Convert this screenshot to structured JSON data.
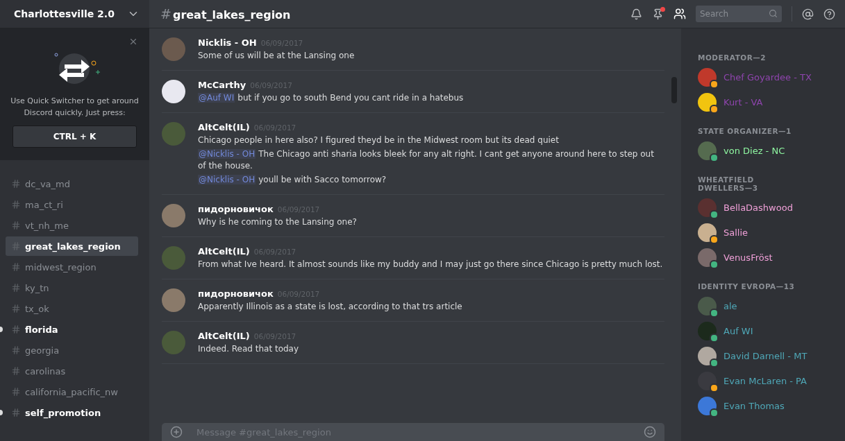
{
  "server": {
    "name": "Charlottesville 2.0"
  },
  "popup": {
    "text": "Use Quick Switcher to get around Discord quickly. Just press:",
    "shortcut": "CTRL + K"
  },
  "channels": [
    {
      "name": "dc_va_md",
      "selected": false,
      "unread": false
    },
    {
      "name": "ma_ct_ri",
      "selected": false,
      "unread": false
    },
    {
      "name": "vt_nh_me",
      "selected": false,
      "unread": false
    },
    {
      "name": "great_lakes_region",
      "selected": true,
      "unread": false
    },
    {
      "name": "midwest_region",
      "selected": false,
      "unread": false
    },
    {
      "name": "ky_tn",
      "selected": false,
      "unread": false
    },
    {
      "name": "tx_ok",
      "selected": false,
      "unread": false
    },
    {
      "name": "florida",
      "selected": false,
      "unread": true
    },
    {
      "name": "georgia",
      "selected": false,
      "unread": false
    },
    {
      "name": "carolinas",
      "selected": false,
      "unread": false
    },
    {
      "name": "california_pacific_nw",
      "selected": false,
      "unread": false
    },
    {
      "name": "self_promotion",
      "selected": false,
      "unread": true
    }
  ],
  "header": {
    "hash": "#",
    "channel": "great_lakes_region",
    "search_placeholder": "Search",
    "pins_unread": true
  },
  "messages": [
    {
      "author": "Nicklis - OH",
      "time": "06/09/2017",
      "lines": [
        {
          "text": "Some of us will be at the Lansing one"
        }
      ]
    },
    {
      "author": "McCarthy",
      "time": "06/09/2017",
      "lines": [
        {
          "mention": "@Auf WI",
          "text": "but if you go to south Bend you cant ride in a hatebus"
        }
      ]
    },
    {
      "author": "AltCelt(IL)",
      "time": "06/09/2017",
      "lines": [
        {
          "text": "Chicago people in here also? I figured theyd be in the Midwest room but its dead quiet"
        },
        {
          "mention": "@Nicklis - OH",
          "text": "The Chicago anti sharia looks bleek for any alt right. I cant get anyone around here to step out of the house."
        },
        {
          "mention": "@Nicklis - OH",
          "text": "youll be with Sacco tomorrow?"
        }
      ]
    },
    {
      "author": "пидорновичок",
      "time": "06/09/2017",
      "lines": [
        {
          "text": "Why is he coming to the Lansing one?"
        }
      ]
    },
    {
      "author": "AltCelt(IL)",
      "time": "06/09/2017",
      "lines": [
        {
          "text": "From what Ive heard. It almost sounds like my buddy and I may just go there since Chicago is pretty much lost."
        }
      ]
    },
    {
      "author": "пидорновичок",
      "time": "06/09/2017",
      "lines": [
        {
          "text": "Apparently Illinois as a state is lost, according to that trs article"
        }
      ]
    },
    {
      "author": "AltCelt(IL)",
      "time": "06/09/2017",
      "lines": [
        {
          "text": "Indeed. Read that today"
        }
      ]
    }
  ],
  "composer": {
    "placeholder": "Message #great_lakes_region"
  },
  "member_groups": [
    {
      "title": "MODERATOR—2",
      "color": "#8e44ad",
      "members": [
        {
          "name": "Chef Goyardee - TX",
          "idle": true
        },
        {
          "name": "Kurt - VA",
          "idle": true
        }
      ]
    },
    {
      "title": "STATE ORGANIZER—1",
      "color": "#8ef5a0",
      "members": [
        {
          "name": "von Diez - NC",
          "idle": false
        }
      ]
    },
    {
      "title": "WHEATFIELD DWELLERS—3",
      "color": "#f0a0d8",
      "members": [
        {
          "name": "BellaDashwood",
          "idle": false
        },
        {
          "name": "Sallie",
          "idle": true
        },
        {
          "name": "VenusFröst",
          "idle": false
        }
      ]
    },
    {
      "title": "IDENTITY EVROPA—13",
      "color": "#4fa8b8",
      "members": [
        {
          "name": "ale",
          "idle": false
        },
        {
          "name": "Auf WI",
          "idle": false
        },
        {
          "name": "David Darnell - MT",
          "idle": false
        },
        {
          "name": "Evan McLaren - PA",
          "idle": true
        },
        {
          "name": "Evan Thomas",
          "idle": false
        }
      ]
    }
  ]
}
